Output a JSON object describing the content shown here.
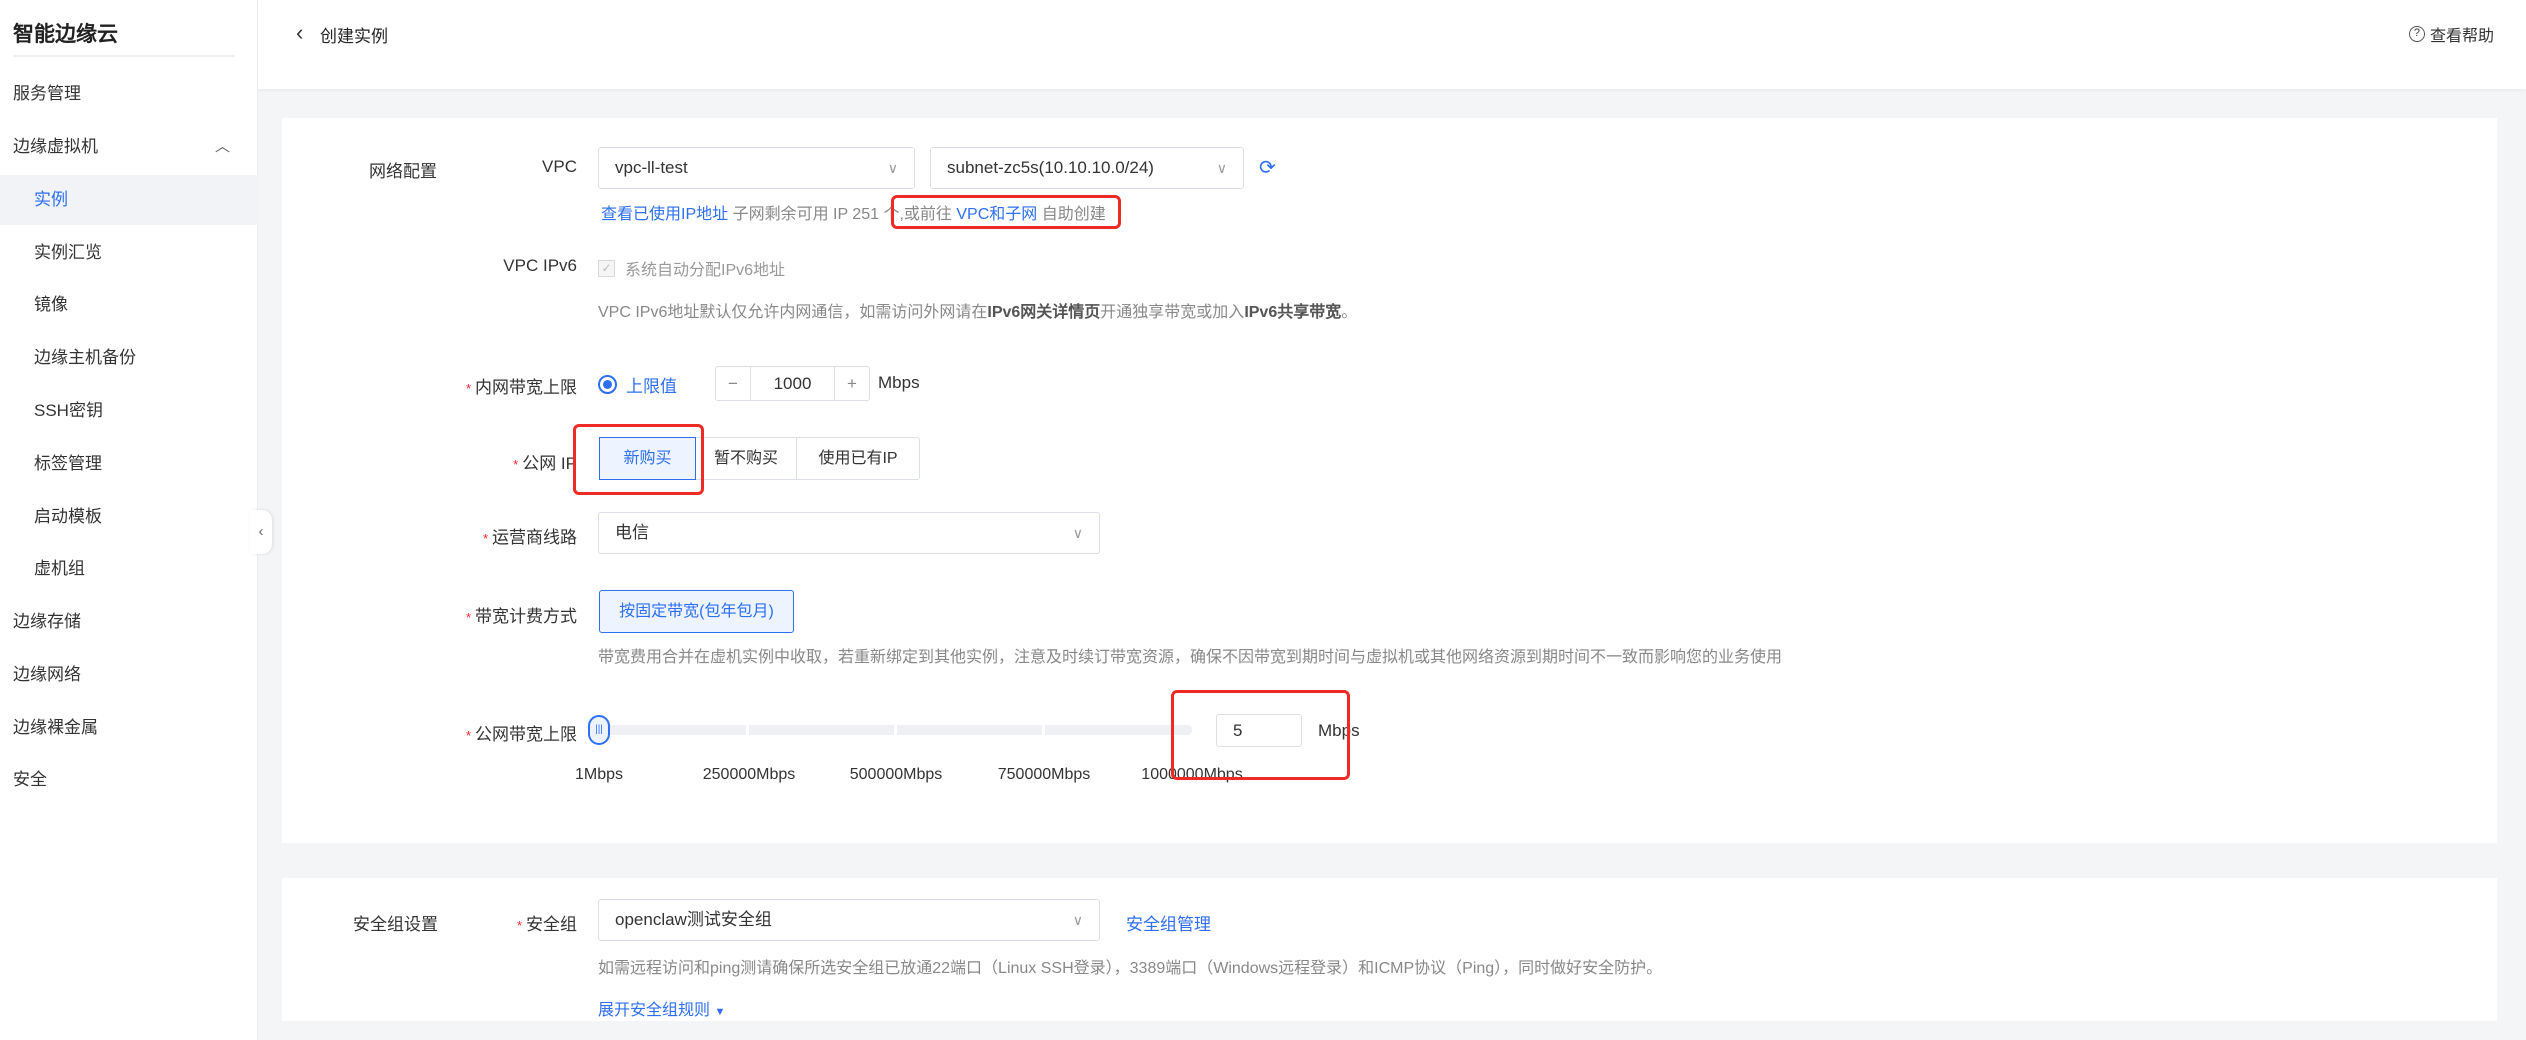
{
  "sidebar": {
    "brand": "智能边缘云",
    "items": [
      {
        "label": "服务管理"
      },
      {
        "label": "边缘虚拟机"
      },
      {
        "label": "实例"
      },
      {
        "label": "实例汇览"
      },
      {
        "label": "镜像"
      },
      {
        "label": "边缘主机备份"
      },
      {
        "label": "SSH密钥"
      },
      {
        "label": "标签管理"
      },
      {
        "label": "启动模板"
      },
      {
        "label": "虚机组"
      },
      {
        "label": "边缘存储"
      },
      {
        "label": "边缘网络"
      },
      {
        "label": "边缘裸金属"
      },
      {
        "label": "安全"
      }
    ],
    "active": "实例"
  },
  "header": {
    "title": "创建实例",
    "help": "查看帮助"
  },
  "network": {
    "section": "网络配置",
    "vpc_label": "VPC",
    "vpc_value": "vpc-ll-test",
    "subnet_value": "subnet-zc5s(10.10.10.0/24)",
    "view_ips_link": "查看已使用IP地址",
    "remaining_ip": "子网剩余可用 IP 251 个",
    "goto_prefix": ",或前往",
    "goto_link": "VPC和子网",
    "goto_suffix": "自助创建",
    "ipv6_label": "VPC IPv6",
    "ipv6_checkbox": "系统自动分配IPv6地址",
    "ipv6_desc_1": "VPC IPv6地址默认仅允许内网通信，如需访问外网请在",
    "ipv6_desc_b1": "IPv6网关详情页",
    "ipv6_desc_2": "开通独享带宽或加入",
    "ipv6_desc_b2": "IPv6共享带宽",
    "ipv6_desc_3": "。",
    "intranet_label": "内网带宽上限",
    "intranet_radio": "上限值",
    "intranet_value": "1000",
    "intranet_unit": "Mbps",
    "public_ip_label": "公网 IP",
    "public_ip_options": [
      "新购买",
      "暂不购买",
      "使用已有IP"
    ],
    "public_ip_selected": "新购买",
    "isp_label": "运营商线路",
    "isp_value": "电信",
    "billing_label": "带宽计费方式",
    "billing_option": "按固定带宽(包年包月)",
    "billing_note": "带宽费用合并在虚机实例中收取，若重新绑定到其他实例，注意及时续订带宽资源，确保不因带宽到期时间与虚拟机或其他网络资源到期时间不一致而影响您的业务使用",
    "bw_label": "公网带宽上限",
    "bw_value": "5",
    "bw_unit": "Mbps",
    "bw_slider_fraction": 0,
    "bw_ticks": [
      "1Mbps",
      "250000Mbps",
      "500000Mbps",
      "750000Mbps",
      "1000000Mbps"
    ]
  },
  "security": {
    "section": "安全组设置",
    "label": "安全组",
    "value": "openclaw测试安全组",
    "manage_link": "安全组管理",
    "note": "如需远程访问和ping测请确保所选安全组已放通22端口（Linux SSH登录），3389端口（Windows远程登录）和ICMP协议（Ping），同时做好安全防护。",
    "expand_link": "展开安全组规则"
  },
  "colors": {
    "accent": "#2d6ff0",
    "highlight": "#ee2a24"
  }
}
